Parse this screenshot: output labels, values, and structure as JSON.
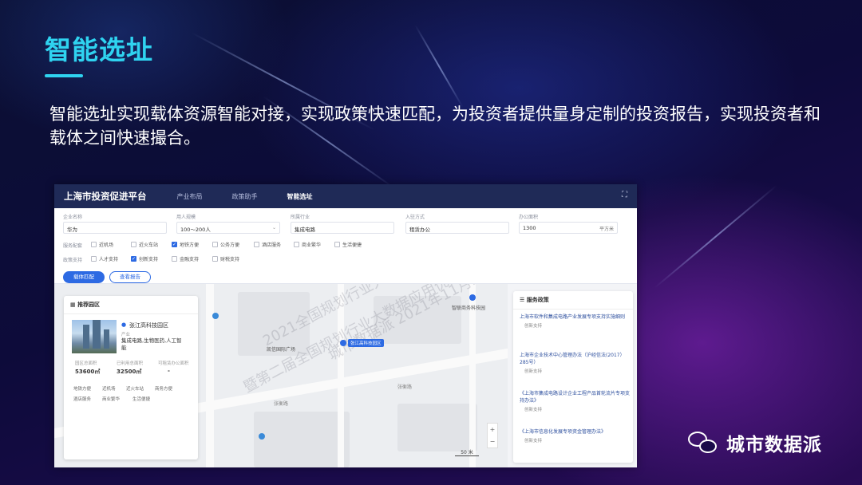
{
  "slide": {
    "title": "智能选址",
    "description": "智能选址实现载体资源智能对接，实现政策快速匹配，为投资者提供量身定制的投资报告，实现投资者和载体之间快速撮合。"
  },
  "app": {
    "name": "上海市投资促进平台",
    "tabs": [
      {
        "label": "产业布局",
        "active": false
      },
      {
        "label": "政策助手",
        "active": false
      },
      {
        "label": "智能选址",
        "active": true
      }
    ],
    "filters": {
      "company_label": "企业名称",
      "company_value": "华为",
      "people_label": "用人规模",
      "people_value": "100～200人",
      "industry_label": "所属行业",
      "industry_value": "集成电路",
      "inbound_label": "入驻方式",
      "inbound_value": "租赁办公",
      "area_label": "办公面积",
      "area_value": "1300",
      "area_unit": "平方米",
      "service_label": "服务配套",
      "services": [
        {
          "label": "近机场",
          "checked": false
        },
        {
          "label": "近火车站",
          "checked": false
        },
        {
          "label": "地铁方便",
          "checked": true
        },
        {
          "label": "公务方便",
          "checked": false
        },
        {
          "label": "酒店服务",
          "checked": false
        },
        {
          "label": "商业繁华",
          "checked": false
        },
        {
          "label": "生活便捷",
          "checked": false
        }
      ],
      "policy_label": "政策支持",
      "policies": [
        {
          "label": "人才支持",
          "checked": false
        },
        {
          "label": "创新支持",
          "checked": true
        },
        {
          "label": "金融支持",
          "checked": false
        },
        {
          "label": "财税支持",
          "checked": false
        }
      ],
      "match_button": "载体匹配",
      "report_button": "查看报告"
    },
    "map": {
      "pois": [
        "凯信国际广场",
        "张江高科技园区",
        "智联商务科技园"
      ],
      "roads": [
        "张衡路",
        "张衡路"
      ],
      "scale": "50 米",
      "zoom_in": "+",
      "zoom_out": "−",
      "watermark": [
        "2021全国规划行业大数据",
        "暨第二届全国规划行业大数据应用优秀",
        "城市数据派  2021年11月21日"
      ]
    },
    "card": {
      "header": "推荐园区",
      "park_name": "张江高科技园区",
      "industry_label": "产业",
      "industry_value": "集成电路,生物医药,人工智能",
      "stats": [
        {
          "label": "园区总面积",
          "value": "53600㎡"
        },
        {
          "label": "已利用总面积",
          "value": "32500㎡"
        },
        {
          "label": "可租赁办公面积",
          "value": "-"
        }
      ],
      "tags": [
        "地铁方便",
        "近机场",
        "近火车站",
        "商务方便",
        "酒店服务",
        "商业繁华",
        "生活便捷"
      ]
    },
    "policy_panel": {
      "header": "服务政策",
      "items": [
        {
          "title": "上海市软件和集成电路产业发展专项支持实施细则",
          "tag": "创新支持"
        },
        {
          "title": "上海市企业技术中心管理办法（沪经信法(2017）285号）",
          "tag": "创新支持"
        },
        {
          "title": "《上海市集成电路设计企业工程产品首轮流片专项支持办法》",
          "tag": "创新支持"
        },
        {
          "title": "《上海市信息化发展专项资金管理办法》",
          "tag": "创新支持"
        }
      ]
    }
  },
  "brand": {
    "name": "城市数据派",
    "icon": "wechat-icon"
  },
  "colors": {
    "title_accent": "#2fd3f0",
    "app_header": "#1f2a57",
    "primary": "#2d6ae3"
  }
}
